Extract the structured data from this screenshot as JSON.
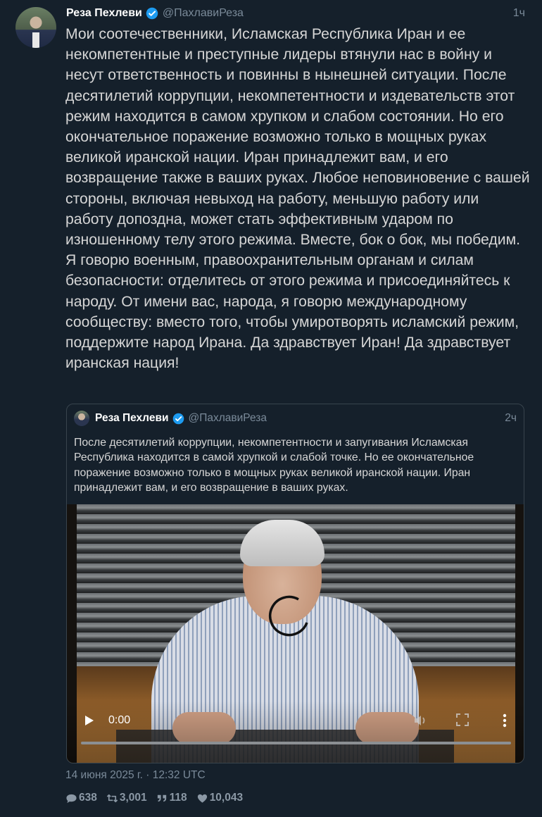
{
  "tweet": {
    "author_name": "Реза Пехлеви",
    "author_handle": "@ПахлавиРеза",
    "time_ago": "1ч",
    "text": "Мои соотечественники, Исламская Республика Иран и ее некомпетентные и преступные лидеры втянули нас в войну и несут ответственность и повинны в нынешней ситуации. После десятилетий коррупции, некомпетентности и издевательств этот режим находится в самом хрупком и слабом состоянии. Но его окончательное поражение возможно только в мощных руках великой иранской нации. Иран принадлежит вам, и его возвращение также в ваших руках. Любое неповиновение с вашей стороны, включая невыход на работу, меньшую работу или работу допоздна, может стать эффективным ударом по изношенному телу этого режима. Вместе, бок о бок, мы победим. Я говорю военным, правоохранительным органам и силам безопасности: отделитесь от этого режима и присоединяйтесь к народу. От имени вас, народа, я говорю международному сообществу: вместо того, чтобы умиротворять исламский режим, поддержите народ Ирана. Да здравствует Иран! Да здравствует иранская нация!",
    "timestamp": "14 июня 2025 г. · 12:32 UTC",
    "stats": {
      "replies": "638",
      "retweets": "3,001",
      "quotes": "118",
      "likes": "10,043"
    }
  },
  "quoted_tweet": {
    "author_name": "Реза Пехлеви",
    "author_handle": "@ПахлавиРеза",
    "time_ago": "2ч",
    "text": "После десятилетий коррупции, некомпетентности и запугивания Исламская Республика находится в самой хрупкой и слабой точке. Но ее окончательное поражение возможно только в мощных руках великой иранской нации. Иран принадлежит вам, и его возвращение в ваших руках.",
    "video": {
      "current_time": "0:00",
      "progress": 0
    }
  },
  "colors": {
    "background": "#15202b",
    "verified": "#1d9bf0",
    "muted_text": "#7a8a99",
    "border": "#38444d"
  },
  "icons": [
    "verified-badge-icon",
    "play-icon",
    "mute-icon",
    "fullscreen-icon",
    "more-menu-icon",
    "reply-icon",
    "retweet-icon",
    "quote-icon",
    "like-icon",
    "loading-spinner-icon"
  ]
}
